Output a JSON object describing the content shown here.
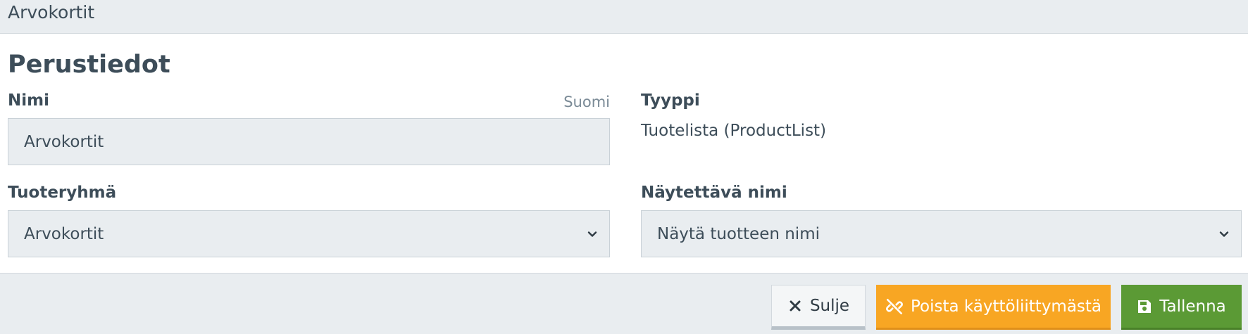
{
  "window": {
    "title": "Arvokortit"
  },
  "section": {
    "title": "Perustiedot"
  },
  "fields": {
    "name": {
      "label": "Nimi",
      "language": "Suomi",
      "value": "Arvokortit"
    },
    "type": {
      "label": "Tyyppi",
      "value": "Tuotelista (ProductList)"
    },
    "product_group": {
      "label": "Tuoteryhmä",
      "selected": "Arvokortit"
    },
    "display_name": {
      "label": "Näytettävä nimi",
      "selected": "Näytä tuotteen nimi"
    }
  },
  "footer": {
    "close_label": "Sulje",
    "remove_label": "Poista käyttöliittymästä",
    "save_label": "Tallenna"
  },
  "colors": {
    "remove_button": "#f8a623",
    "save_button": "#5b9a35",
    "field_background": "#e9edf0",
    "text": "#3d4d59"
  },
  "icons": {
    "close": "close-icon",
    "remove": "unlink-icon",
    "save": "save-icon",
    "select": "chevron-down-icon"
  }
}
